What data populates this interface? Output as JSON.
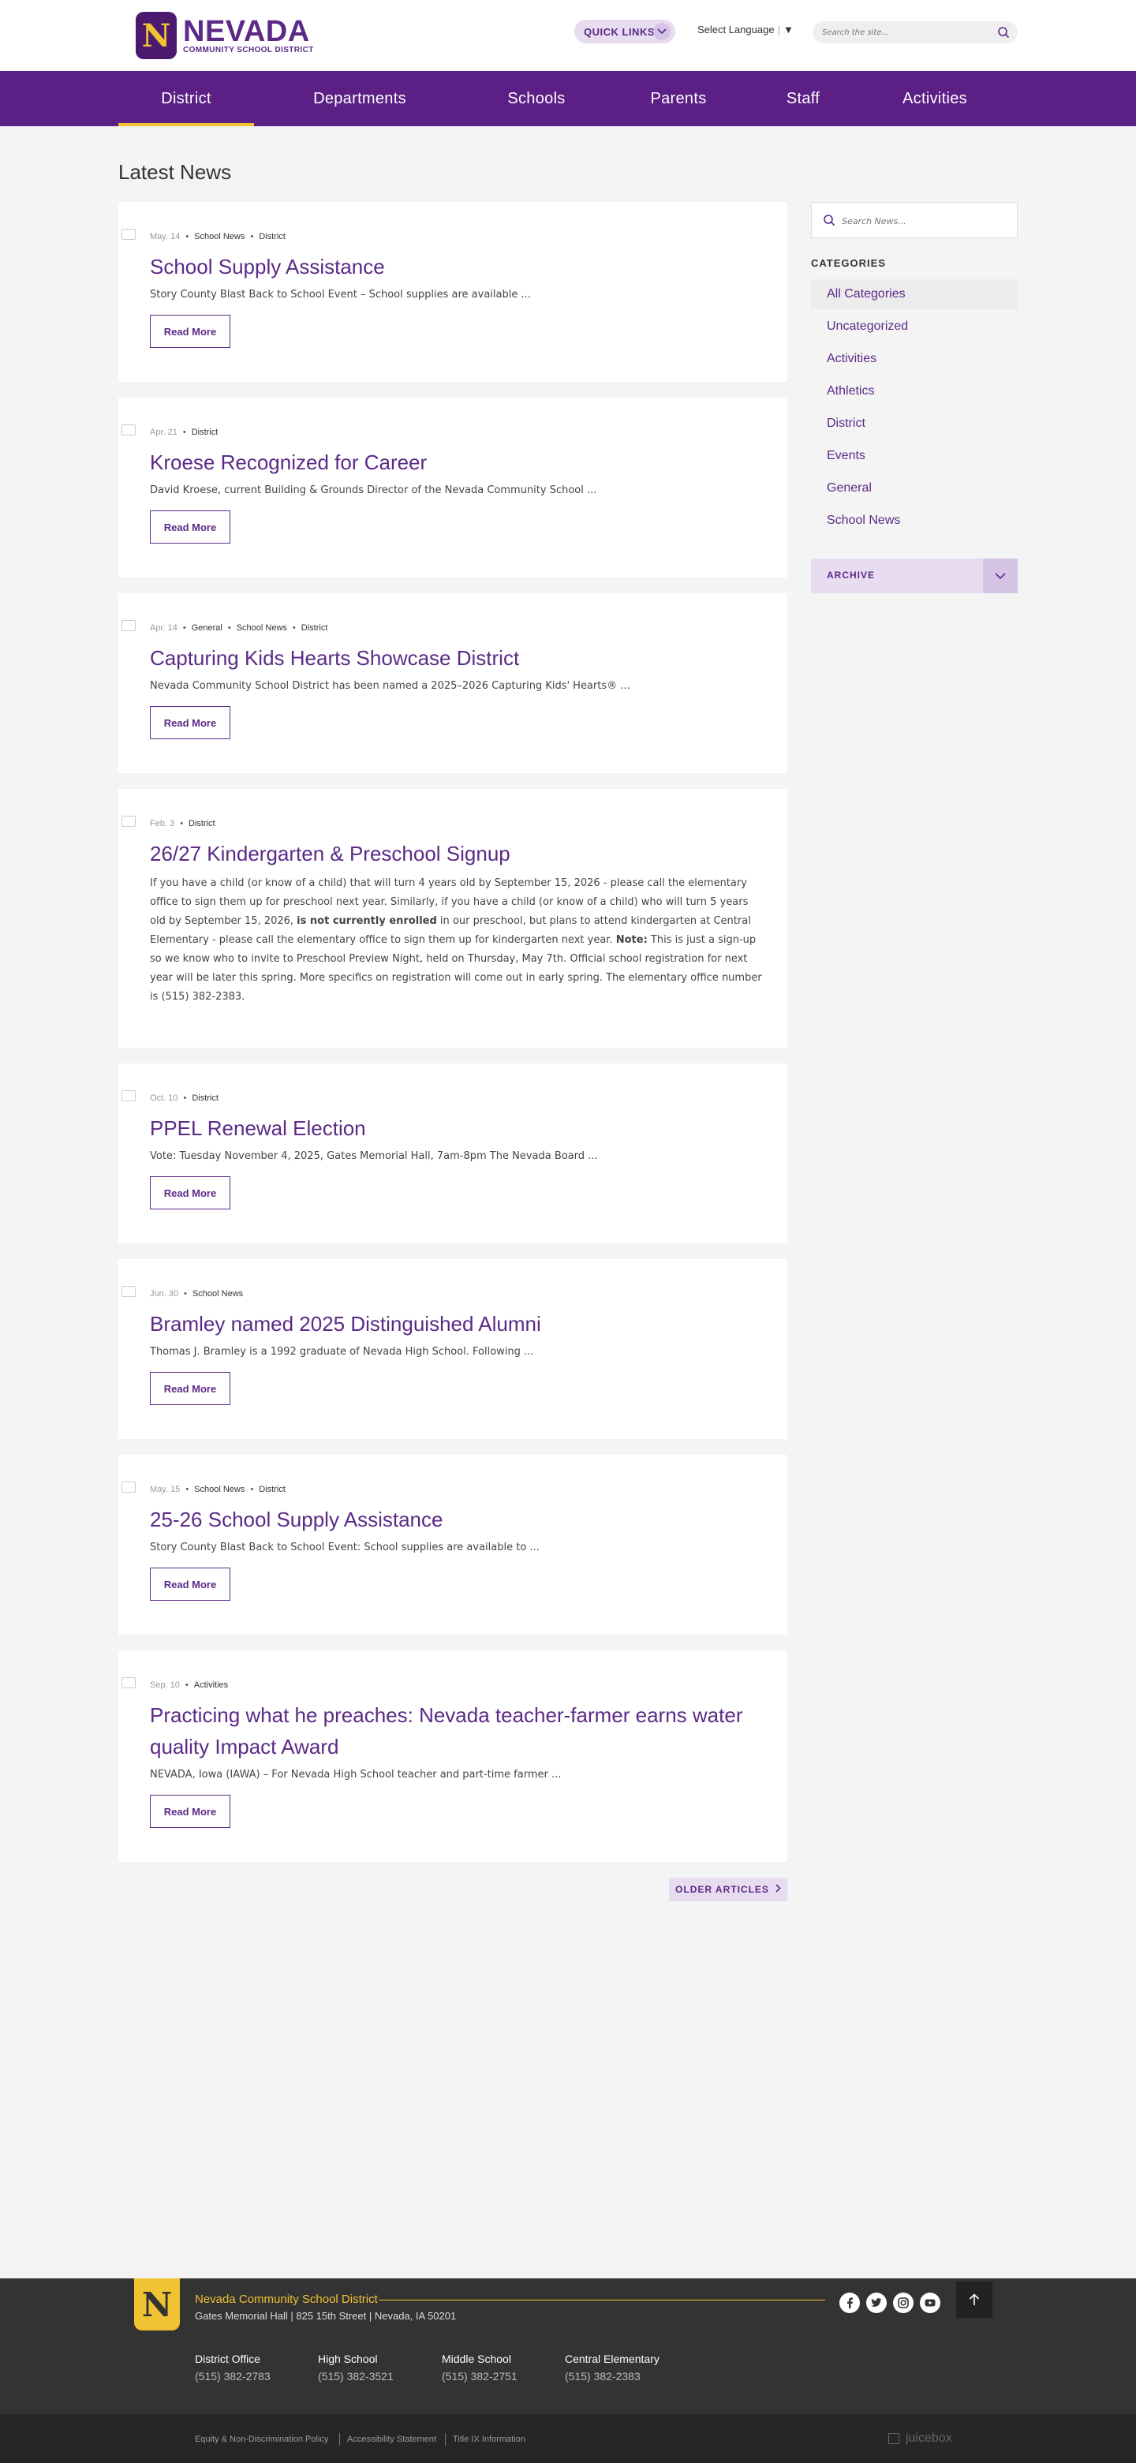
{
  "header": {
    "logo_title": "NEVADA",
    "logo_subtitle": "COMMUNITY SCHOOL DISTRICT",
    "logo_letter": "N",
    "quick_links": "QUICK LINKS",
    "select_language": "Select Language",
    "search_placeholder": "Search the site..."
  },
  "nav": {
    "items": [
      {
        "label": "District",
        "active": true
      },
      {
        "label": "Departments"
      },
      {
        "label": "Schools"
      },
      {
        "label": "Parents"
      },
      {
        "label": "Staff"
      },
      {
        "label": "Activities"
      }
    ]
  },
  "main": {
    "title": "Latest News",
    "read_more": "Read More",
    "older_articles": "OLDER ARTICLES",
    "posts": [
      {
        "date": "May. 14",
        "categories": [
          "School News",
          "District"
        ],
        "title": "School Supply Assistance",
        "excerpt": "Story County Blast Back to School Event – School supplies are available ..."
      },
      {
        "date": "Apr. 21",
        "categories": [
          "District"
        ],
        "title": "Kroese Recognized for Career",
        "excerpt": "David Kroese, current Building & Grounds Director of the Nevada Community School ..."
      },
      {
        "date": "Apr. 14",
        "categories": [
          "General",
          "School News",
          "District"
        ],
        "title": "Capturing Kids Hearts Showcase District",
        "excerpt": "Nevada Community School District has been named a 2025–2026 Capturing Kids' Hearts® ..."
      },
      {
        "date": "Feb. 3",
        "categories": [
          "District"
        ],
        "title": "26/27 Kindergarten & Preschool Signup",
        "body": {
          "p1": "If you have a child (or know of a child) that will turn 4 years old by September 15, 2026 - please call the elementary office to sign them up for preschool next year. Similarly, if you have a child (or know of a child) who will turn 5 years old by September 15, 2026, ",
          "bold1": "is not currently enrolled",
          "p2": " in our preschool, but plans to attend kindergarten at Central Elementary - please call the elementary office to sign them up for kindergarten next year. ",
          "bold2": "Note:",
          "p3": " This is just a sign-up so we know who to invite to Preschool Preview Night, held on Thursday, May 7th.  Official school registration for next year will be later this spring.  More specifics on registration will come out in early spring. The elementary office number is (515) 382-2383."
        }
      },
      {
        "date": "Oct. 10",
        "categories": [
          "District"
        ],
        "title": "PPEL Renewal Election",
        "excerpt": "Vote: Tuesday November 4, 2025, Gates Memorial Hall, 7am-8pm The Nevada Board ..."
      },
      {
        "date": "Jun. 30",
        "categories": [
          "School News"
        ],
        "title": "Bramley named 2025 Distinguished Alumni",
        "excerpt": "Thomas J. Bramley is a 1992 graduate of Nevada High School. Following ..."
      },
      {
        "date": "May. 15",
        "categories": [
          "School News",
          "District"
        ],
        "title": "25-26 School Supply Assistance",
        "excerpt": "Story County Blast Back to School Event: School supplies are available to ..."
      },
      {
        "date": "Sep. 10",
        "categories": [
          "Activities"
        ],
        "title": "Practicing what he preaches: Nevada teacher-farmer earns water quality Impact Award",
        "excerpt": "NEVADA, Iowa (IAWA) – For Nevada High School teacher and part-time farmer ..."
      }
    ]
  },
  "sidebar": {
    "search_placeholder": "Search News...",
    "categories_heading": "CATEGORIES",
    "categories": [
      "All Categories",
      "Uncategorized",
      "Activities",
      "Athletics",
      "District",
      "Events",
      "General",
      "School News"
    ],
    "archive": "ARCHIVE"
  },
  "footer": {
    "logo_letter": "N",
    "district_name": "Nevada Community School District",
    "address": "Gates Memorial Hall | 825 15th Street | Nevada, IA 50201",
    "contacts": [
      {
        "label": "District Office",
        "phone": "(515) 382-2783"
      },
      {
        "label": "High School",
        "phone": "(515) 382-3521"
      },
      {
        "label": "Middle School",
        "phone": "(515) 382-2751"
      },
      {
        "label": "Central Elementary",
        "phone": "(515) 382-2383"
      }
    ],
    "links": [
      "Equity & Non-Discrimination Policy",
      "Accessibility Statement",
      "Title IX Information"
    ],
    "credit": "juicebox"
  },
  "colors": {
    "brand_purple": "#5b1f86",
    "accent_gold": "#f1c232",
    "footer_dark": "#333333"
  }
}
